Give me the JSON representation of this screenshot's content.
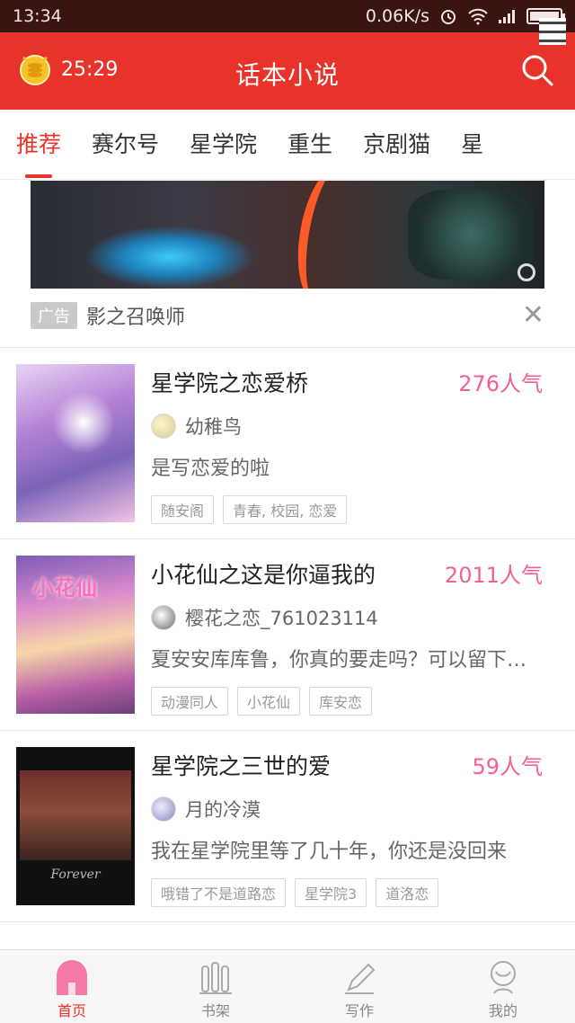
{
  "status_bar": {
    "time": "13:34",
    "speed": "0.06K/s"
  },
  "header": {
    "timer": "25:29",
    "title": "话本小说"
  },
  "tabs": [
    {
      "label": "推荐",
      "active": true
    },
    {
      "label": "赛尔号",
      "active": false
    },
    {
      "label": "星学院",
      "active": false
    },
    {
      "label": "重生",
      "active": false
    },
    {
      "label": "京剧猫",
      "active": false
    },
    {
      "label": "星",
      "active": false
    }
  ],
  "ad": {
    "badge": "广告",
    "title": "影之召唤师"
  },
  "novels": [
    {
      "title": "星学院之恋爱桥",
      "popularity": "276人气",
      "author": "幼稚鸟",
      "summary": "是写恋爱的啦",
      "tags": [
        "随安阁",
        "青春, 校园, 恋爱"
      ]
    },
    {
      "title": "小花仙之这是你逼我的",
      "popularity": "2011人气",
      "author": "樱花之恋_761023114",
      "summary": "夏安安库库鲁，你真的要走吗？可以留下来陪我吗",
      "cover_text": "小花仙",
      "tags": [
        "动漫同人",
        "小花仙",
        "库安恋"
      ]
    },
    {
      "title": "星学院之三世的爱",
      "popularity": "59人气",
      "author": "月的冷漠",
      "summary": "我在星学院里等了几十年，你还是没回来",
      "cover_text": "Forever",
      "tags": [
        "哦错了不是道路恋",
        "星学院3",
        "道洛恋"
      ]
    }
  ],
  "bottom_nav": [
    {
      "label": "首页",
      "icon": "home-icon",
      "active": true
    },
    {
      "label": "书架",
      "icon": "bookshelf-icon",
      "active": false
    },
    {
      "label": "写作",
      "icon": "pen-icon",
      "active": false
    },
    {
      "label": "我的",
      "icon": "profile-icon",
      "active": false
    }
  ],
  "colors": {
    "accent": "#e8332a",
    "popularity": "#f06292"
  }
}
